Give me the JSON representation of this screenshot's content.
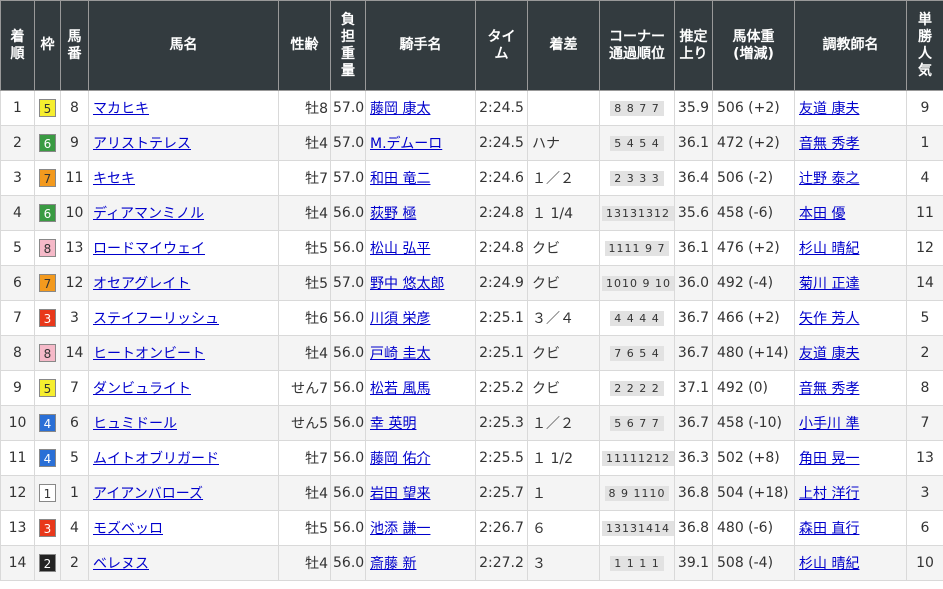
{
  "headers": {
    "rank": "着順",
    "waku": "枠",
    "umaban": "馬番",
    "horse": "馬名",
    "sexage": "性齢",
    "weight": "負担重量",
    "jockey": "騎手名",
    "time": "タイム",
    "margin": "着差",
    "passing": "コーナー通過順位",
    "last3f": "推定上り",
    "body_weight": "馬体重(増減)",
    "trainer": "調教師名",
    "popularity": "単勝人気"
  },
  "waku_colors": {
    "1": {
      "bg": "#ffffff",
      "fg": "#333333"
    },
    "2": {
      "bg": "#222222",
      "fg": "#ffffff"
    },
    "3": {
      "bg": "#e8381b",
      "fg": "#ffffff"
    },
    "4": {
      "bg": "#2a6fd6",
      "fg": "#ffffff"
    },
    "5": {
      "bg": "#f6ee2f",
      "fg": "#333333"
    },
    "6": {
      "bg": "#3a9b43",
      "fg": "#ffffff"
    },
    "7": {
      "bg": "#f39a1e",
      "fg": "#333333"
    },
    "8": {
      "bg": "#f5b9c8",
      "fg": "#333333"
    }
  },
  "rows": [
    {
      "rank": "1",
      "waku": "5",
      "umaban": "8",
      "horse": "マカヒキ",
      "sexage": "牡8",
      "weight": "57.0",
      "jockey": "藤岡 康太",
      "time": "2:24.5",
      "margin": "",
      "passing": "8 8 7 7",
      "last3f": "35.9",
      "body_weight": "506 (+2)",
      "trainer": "友道 康夫",
      "popularity": "9"
    },
    {
      "rank": "2",
      "waku": "6",
      "umaban": "9",
      "horse": "アリストテレス",
      "sexage": "牡4",
      "weight": "57.0",
      "jockey": "M.デムーロ",
      "time": "2:24.5",
      "margin": "ハナ",
      "passing": "5 4 5 4",
      "last3f": "36.1",
      "body_weight": "472 (+2)",
      "trainer": "音無 秀孝",
      "popularity": "1"
    },
    {
      "rank": "3",
      "waku": "7",
      "umaban": "11",
      "horse": "キセキ",
      "sexage": "牡7",
      "weight": "57.0",
      "jockey": "和田 竜二",
      "time": "2:24.6",
      "margin": "１／２",
      "passing": "2 3 3 3",
      "last3f": "36.4",
      "body_weight": "506 (-2)",
      "trainer": "辻野 泰之",
      "popularity": "4"
    },
    {
      "rank": "4",
      "waku": "6",
      "umaban": "10",
      "horse": "ディアマンミノル",
      "sexage": "牡4",
      "weight": "56.0",
      "jockey": "荻野 極",
      "time": "2:24.8",
      "margin": "１ 1/4",
      "passing": "13131312",
      "last3f": "35.6",
      "body_weight": "458 (-6)",
      "trainer": "本田 優",
      "popularity": "11"
    },
    {
      "rank": "5",
      "waku": "8",
      "umaban": "13",
      "horse": "ロードマイウェイ",
      "sexage": "牡5",
      "weight": "56.0",
      "jockey": "松山 弘平",
      "time": "2:24.8",
      "margin": "クビ",
      "passing": "1111 9 7",
      "last3f": "36.1",
      "body_weight": "476 (+2)",
      "trainer": "杉山 晴紀",
      "popularity": "12"
    },
    {
      "rank": "6",
      "waku": "7",
      "umaban": "12",
      "horse": "オセアグレイト",
      "sexage": "牡5",
      "weight": "57.0",
      "jockey": "野中 悠太郎",
      "time": "2:24.9",
      "margin": "クビ",
      "passing": "1010 9 10",
      "last3f": "36.0",
      "body_weight": "492 (-4)",
      "trainer": "菊川 正達",
      "popularity": "14"
    },
    {
      "rank": "7",
      "waku": "3",
      "umaban": "3",
      "horse": "ステイフーリッシュ",
      "sexage": "牡6",
      "weight": "56.0",
      "jockey": "川須 栄彦",
      "time": "2:25.1",
      "margin": "３／４",
      "passing": "4 4 4 4",
      "last3f": "36.7",
      "body_weight": "466 (+2)",
      "trainer": "矢作 芳人",
      "popularity": "5"
    },
    {
      "rank": "8",
      "waku": "8",
      "umaban": "14",
      "horse": "ヒートオンビート",
      "sexage": "牡4",
      "weight": "56.0",
      "jockey": "戸崎 圭太",
      "time": "2:25.1",
      "margin": "クビ",
      "passing": "7 6 5 4",
      "last3f": "36.7",
      "body_weight": "480 (+14)",
      "trainer": "友道 康夫",
      "popularity": "2"
    },
    {
      "rank": "9",
      "waku": "5",
      "umaban": "7",
      "horse": "ダンビュライト",
      "sexage": "せん7",
      "weight": "56.0",
      "jockey": "松若 風馬",
      "time": "2:25.2",
      "margin": "クビ",
      "passing": "2 2 2 2",
      "last3f": "37.1",
      "body_weight": "492 (0)",
      "trainer": "音無 秀孝",
      "popularity": "8"
    },
    {
      "rank": "10",
      "waku": "4",
      "umaban": "6",
      "horse": "ヒュミドール",
      "sexage": "せん5",
      "weight": "56.0",
      "jockey": "幸 英明",
      "time": "2:25.3",
      "margin": "１／２",
      "passing": "5 6 7 7",
      "last3f": "36.7",
      "body_weight": "458 (-10)",
      "trainer": "小手川 準",
      "popularity": "7"
    },
    {
      "rank": "11",
      "waku": "4",
      "umaban": "5",
      "horse": "ムイトオブリガード",
      "sexage": "牡7",
      "weight": "56.0",
      "jockey": "藤岡 佑介",
      "time": "2:25.5",
      "margin": "１ 1/2",
      "passing": "11111212",
      "last3f": "36.3",
      "body_weight": "502 (+8)",
      "trainer": "角田 晃一",
      "popularity": "13"
    },
    {
      "rank": "12",
      "waku": "1",
      "umaban": "1",
      "horse": "アイアンバローズ",
      "sexage": "牡4",
      "weight": "56.0",
      "jockey": "岩田 望来",
      "time": "2:25.7",
      "margin": "１",
      "passing": "8 9 1110",
      "last3f": "36.8",
      "body_weight": "504 (+18)",
      "trainer": "上村 洋行",
      "popularity": "3"
    },
    {
      "rank": "13",
      "waku": "3",
      "umaban": "4",
      "horse": "モズベッロ",
      "sexage": "牡5",
      "weight": "56.0",
      "jockey": "池添 謙一",
      "time": "2:26.7",
      "margin": "６",
      "passing": "13131414",
      "last3f": "36.8",
      "body_weight": "480 (-6)",
      "trainer": "森田 直行",
      "popularity": "6"
    },
    {
      "rank": "14",
      "waku": "2",
      "umaban": "2",
      "horse": "ベレヌス",
      "sexage": "牡4",
      "weight": "56.0",
      "jockey": "斎藤 新",
      "time": "2:27.2",
      "margin": "３",
      "passing": "1 1 1 1",
      "last3f": "39.1",
      "body_weight": "508 (-4)",
      "trainer": "杉山 晴紀",
      "popularity": "10"
    }
  ]
}
